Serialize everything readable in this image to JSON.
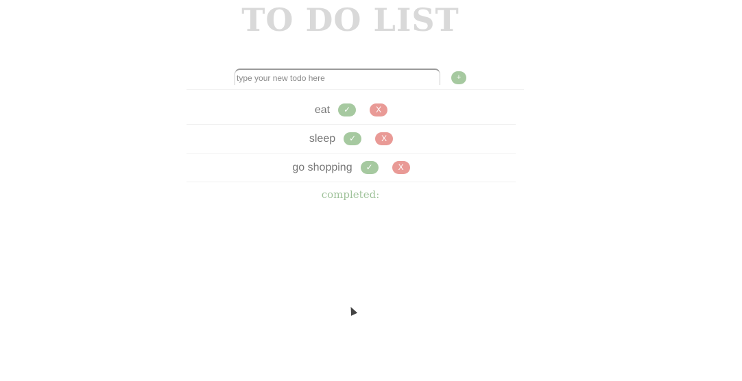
{
  "header": {
    "title": "TO DO LIST"
  },
  "new_todo": {
    "placeholder": "type your new todo here",
    "value": "",
    "add_label": "+"
  },
  "todos": [
    {
      "text": "eat",
      "done_label": "✓",
      "remove_label": "X"
    },
    {
      "text": "sleep",
      "done_label": "✓",
      "remove_label": "X"
    },
    {
      "text": "go shopping",
      "done_label": "✓",
      "remove_label": "X"
    }
  ],
  "completed": {
    "label": "completed:",
    "items": []
  },
  "colors": {
    "title": "#d9d9d9",
    "done": "#a6c9a0",
    "remove": "#e99a96",
    "completed_label": "#9fc29a"
  },
  "icons": {
    "add": "plus-icon",
    "done": "check-icon",
    "remove": "x-icon",
    "cursor": "mouse-pointer-icon"
  }
}
